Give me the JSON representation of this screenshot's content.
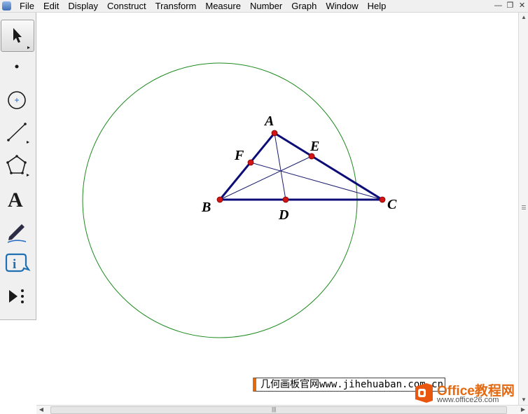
{
  "menu": {
    "items": [
      "File",
      "Edit",
      "Display",
      "Construct",
      "Transform",
      "Measure",
      "Number",
      "Graph",
      "Window",
      "Help"
    ]
  },
  "window_controls": [
    "minimize-icon",
    "restore-icon",
    "close-icon"
  ],
  "toolbox": {
    "tools": [
      {
        "name": "arrow-select-tool",
        "icon": "arrow-icon",
        "selected": true
      },
      {
        "name": "point-tool",
        "icon": "point-icon"
      },
      {
        "name": "compass-tool",
        "icon": "circle-icon"
      },
      {
        "name": "straightedge-tool",
        "icon": "line-icon"
      },
      {
        "name": "polygon-tool",
        "icon": "pentagon-icon"
      },
      {
        "name": "text-tool",
        "icon": "text-A-icon",
        "glyph": "A"
      },
      {
        "name": "marker-tool",
        "icon": "pen-icon"
      },
      {
        "name": "information-tool",
        "icon": "info-icon"
      },
      {
        "name": "custom-tool",
        "icon": "play-more-icon"
      }
    ]
  },
  "sketch": {
    "labels": {
      "A": "A",
      "B": "B",
      "C": "C",
      "D": "D",
      "E": "E",
      "F": "F"
    },
    "colors": {
      "circle": "#1e8a1e",
      "triangle": "#0c0c78",
      "medians": "#1a1a6e",
      "points": "#d21414"
    }
  },
  "watermarks": {
    "site_caption": "几何画板官网www.jihehuaban.com.cn",
    "office_logo_line1": "Office教程网",
    "office_logo_line2": "www.office26.com"
  },
  "scrollbars": {
    "grip_glyph": "|||"
  }
}
